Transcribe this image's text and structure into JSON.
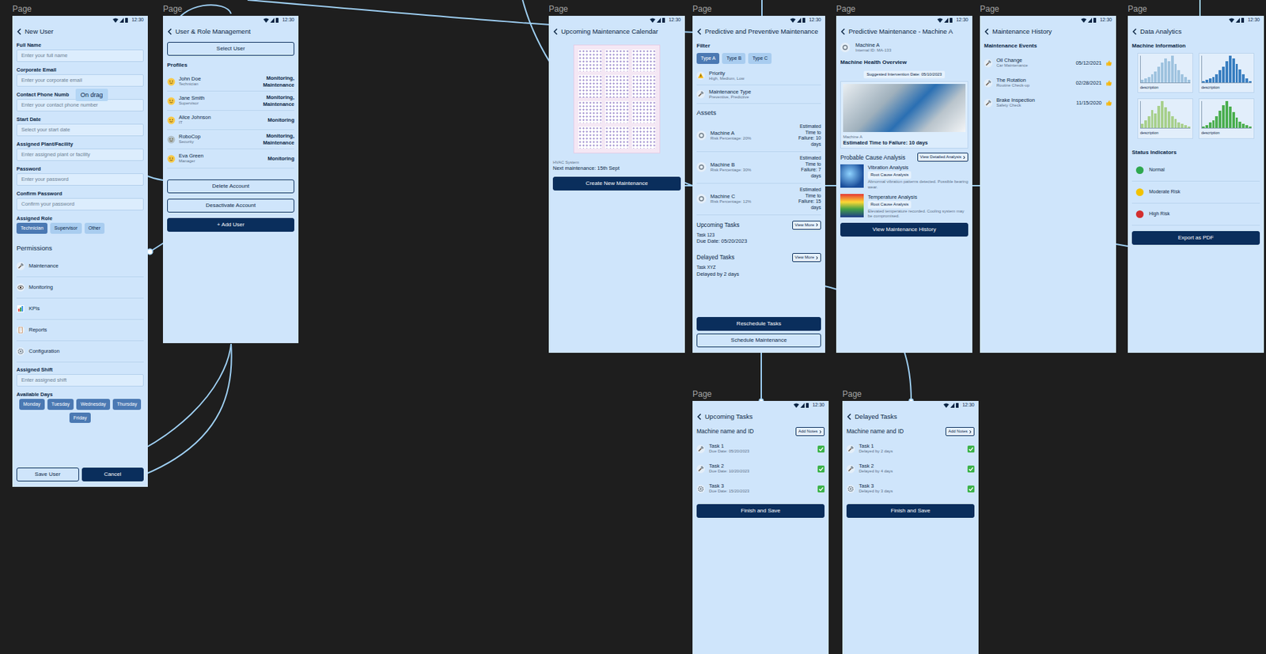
{
  "tooltip": {
    "text": "On drag"
  },
  "new_user": {
    "page_label": "Page",
    "time": "12:30",
    "title": "New User",
    "fields": [
      {
        "label": "Full Name",
        "placeholder": "Enter your full name"
      },
      {
        "label": "Corporate Email",
        "placeholder": "Enter your corporate email"
      },
      {
        "label": "Contact Phone Numb",
        "placeholder": "Enter your contact phone number"
      },
      {
        "label": "Start Date",
        "placeholder": "Select your start date"
      },
      {
        "label": "Assigned Plant/Facility",
        "placeholder": "Enter assigned plant or facility"
      },
      {
        "label": "Password",
        "placeholder": "Enter your password"
      },
      {
        "label": "Confirm Password",
        "placeholder": "Confirm your password"
      }
    ],
    "role": {
      "label": "Assigned Role",
      "options": [
        {
          "label": "Technician",
          "selected": true
        },
        {
          "label": "Supervisor",
          "selected": false
        },
        {
          "label": "Other",
          "selected": false
        }
      ]
    },
    "permissions": {
      "title": "Permissions",
      "items": [
        {
          "label": "Maintenance"
        },
        {
          "label": "Monitoring"
        },
        {
          "label": "KPIs"
        },
        {
          "label": "Reports"
        },
        {
          "label": "Configuration"
        }
      ]
    },
    "shift": {
      "label": "Assigned Shift",
      "placeholder": "Enter assigned shift"
    },
    "days": {
      "label": "Available Days",
      "options": [
        {
          "label": "Monday",
          "selected": true
        },
        {
          "label": "Tuesday",
          "selected": true
        },
        {
          "label": "Wednesday",
          "selected": true
        },
        {
          "label": "Thursday",
          "selected": true
        },
        {
          "label": "Friday",
          "selected": true
        }
      ]
    },
    "buttons": [
      {
        "label": "Save User",
        "kind": "outline"
      },
      {
        "label": "Cancel",
        "kind": "filled"
      }
    ]
  },
  "user_management": {
    "page_label": "Page",
    "time": "12:30",
    "title": "User & Role Management",
    "select_button": "Select User",
    "profiles_title": "Profiles",
    "profiles": [
      {
        "name": "John Doe",
        "role": "Technician",
        "access": "Monitoring, Maintenance"
      },
      {
        "name": "Jane Smith",
        "role": "Supervisor",
        "access": "Monitoring, Maintenance"
      },
      {
        "name": "Alice Johnson",
        "role": "IT",
        "access": "Monitoring"
      },
      {
        "name": "RoboCop",
        "role": "Security",
        "access": "Monitoring, Maintenance"
      },
      {
        "name": "Eva Green",
        "role": "Manager",
        "access": "Monitoring"
      }
    ],
    "buttons": [
      {
        "label": "Delete Account",
        "kind": "outline"
      },
      {
        "label": "Desactivate Account",
        "kind": "outline"
      },
      {
        "label": "+ Add User",
        "kind": "filled"
      }
    ]
  },
  "calendar": {
    "page_label": "Page",
    "time": "12:30",
    "title": "Upcoming Maintenance Calendar",
    "system": "HVAC System",
    "next": "Next maintenance: 15th Sept",
    "button": "Create New Maintenance"
  },
  "maintenance_overview": {
    "page_label": "Page",
    "time": "12:30",
    "title": "Predictive and Preventive Maintenance",
    "filter_title": "Filter",
    "types": [
      {
        "label": "Type A",
        "selected": true
      },
      {
        "label": "Type B",
        "selected": false
      },
      {
        "label": "Type C",
        "selected": false
      }
    ],
    "filters": [
      {
        "title": "Priority",
        "subtitle": "High, Medium, Low"
      },
      {
        "title": "Maintenance Type",
        "subtitle": "Preventive, Predictive"
      }
    ],
    "assets_title": "Assets",
    "assets": [
      {
        "name": "Machine A",
        "risk": "Risk Percentage: 20%",
        "ttf": "Estimated Time to Failure: 10 days"
      },
      {
        "name": "Machine B",
        "risk": "Risk Percentage: 30%",
        "ttf": "Estimated Time to Failure: 7 days"
      },
      {
        "name": "Machine C",
        "risk": "Risk Percentage: 12%",
        "ttf": "Estimated Time to Failure: 15 days"
      }
    ],
    "upcoming": {
      "title": "Upcoming Tasks",
      "more": "View More",
      "task": "Task 123",
      "detail": "Due Date: 05/20/2023"
    },
    "delayed": {
      "title": "Delayed Tasks",
      "more": "View More",
      "task": "Task XYZ",
      "detail": "Delayed by 2 days"
    },
    "buttons": [
      {
        "label": "Reschedule Tasks",
        "kind": "filled"
      },
      {
        "label": "Schedule Maintenance",
        "kind": "outline"
      }
    ]
  },
  "machine_detail": {
    "page_label": "Page",
    "time": "12:30",
    "title": "Predictive Maintenance - Machine A",
    "machine": "Machine A",
    "machine_id": "Internal ID: MA-133",
    "health_title": "Machine Health Overview",
    "intervention": "Suggested Intervention Date: 05/10/2023",
    "photo_caption": "Machine A",
    "ttf": "Estimated Time to Failure: 10 days",
    "cause_title": "Probable Cause Analysis",
    "cause_button": "View Detailed Analysis",
    "causes": [
      {
        "title": "Vibration Analysis",
        "tag": "Root Cause Analysis",
        "text": "Abnormal vibration patterns detected. Possible bearing wear."
      },
      {
        "title": "Temperature Analysis",
        "tag": "Root Cause Analysis",
        "text": "Elevated temperature recorded. Cooling system may be compromised."
      }
    ],
    "button": "View Maintenance History"
  },
  "history": {
    "page_label": "Page",
    "time": "12:30",
    "title": "Maintenance History",
    "events_title": "Maintenance Events",
    "events": [
      {
        "title": "Oil Change",
        "subtitle": "Car Maintenance",
        "date": "05/12/2021"
      },
      {
        "title": "The Rotation",
        "subtitle": "Routine Check-up",
        "date": "02/28/2021"
      },
      {
        "title": "Brake Inspection",
        "subtitle": "Safety Check",
        "date": "11/15/2020"
      }
    ]
  },
  "analytics": {
    "page_label": "Page",
    "time": "12:30",
    "title": "Data Analytics",
    "info_title": "Machine Information",
    "charts": [
      {
        "caption": "description",
        "color": "#9fc3df",
        "values": [
          2,
          3,
          4,
          6,
          8,
          12,
          15,
          18,
          16,
          20,
          14,
          9,
          6,
          4,
          2
        ]
      },
      {
        "caption": "description",
        "color": "#3a7fc1",
        "values": [
          1,
          2,
          3,
          4,
          6,
          9,
          12,
          16,
          20,
          18,
          14,
          10,
          6,
          3,
          1
        ]
      },
      {
        "caption": "description",
        "color": "#a8d08d",
        "values": [
          3,
          5,
          8,
          12,
          10,
          15,
          18,
          14,
          11,
          8,
          6,
          4,
          3,
          2,
          1
        ]
      },
      {
        "caption": "description",
        "color": "#4caf50",
        "values": [
          1,
          2,
          4,
          6,
          9,
          13,
          17,
          20,
          16,
          12,
          8,
          5,
          3,
          2,
          1
        ]
      }
    ],
    "status_title": "Status Indicators",
    "statuses": [
      {
        "label": "Normal",
        "color": "#2fa84f"
      },
      {
        "label": "Moderate Risk",
        "color": "#f2c200"
      },
      {
        "label": "High Risk",
        "color": "#d32f2f"
      }
    ],
    "button": "Export as PDF"
  },
  "upcoming_tasks": {
    "page_label": "Page",
    "time": "12:30",
    "title": "Upcoming Tasks",
    "machine": "Machine name and ID",
    "notes": "Add Notes",
    "tasks": [
      {
        "name": "Task 1",
        "detail": "Due Date: 05/20/2023",
        "checked": true
      },
      {
        "name": "Task 2",
        "detail": "Due Date: 10/20/2023",
        "checked": true
      },
      {
        "name": "Task 3",
        "detail": "Due Date: 15/20/2023",
        "checked": true
      }
    ],
    "button": "Finish and Save"
  },
  "delayed_tasks": {
    "page_label": "Page",
    "time": "12:30",
    "title": "Delayed Tasks",
    "machine": "Machine name and ID",
    "notes": "Add Notes",
    "tasks": [
      {
        "name": "Task 1",
        "detail": "Delayed by 2 days",
        "checked": true
      },
      {
        "name": "Task 2",
        "detail": "Delayed by 4 days",
        "checked": true
      },
      {
        "name": "Task 3",
        "detail": "Delayed by 3 days",
        "checked": true
      }
    ],
    "button": "Finish and Save"
  }
}
